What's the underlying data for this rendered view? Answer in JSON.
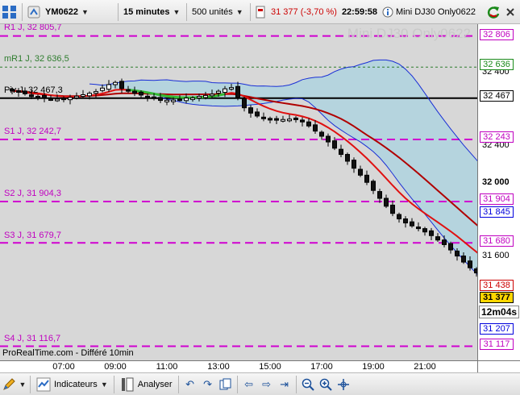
{
  "toolbar": {
    "instrument": "YM0622",
    "timeframe": "15 minutes",
    "units": "500 unités",
    "price_change": "31 377 (-3,70 %)",
    "time": "22:59:58",
    "name": "Mini DJ30 Only0622",
    "accent": "#cc0000"
  },
  "chart": {
    "watermark": "Mini DJ30 Only0622",
    "footer_note": "ProRealTime.com - Différé 10min",
    "levels": [
      {
        "key": "r1",
        "label": "R1 J, 32 805,7",
        "tag": "32 806"
      },
      {
        "key": "mr1",
        "label": "mR1 J, 32 636,5",
        "tag": "32 636"
      },
      {
        "key": "piv",
        "label": "Piv J, 32 467,3",
        "tag": "32 467"
      },
      {
        "key": "s1",
        "label": "S1 J, 32 242,7",
        "tag": "32 243"
      },
      {
        "key": "s2",
        "label": "S2 J, 31 904,3",
        "tag": "31 904"
      },
      {
        "key": "s3",
        "label": "S3 J, 31 679,7",
        "tag": "31 680"
      },
      {
        "key": "s4",
        "label": "S4 J, 31 116,7",
        "tag": "31 117"
      }
    ],
    "indicator_tags": {
      "upper_band": "31 845",
      "moving_average": "31 438",
      "last_price": "31 377",
      "lower_band": "31 207"
    },
    "countdown": "12m04s",
    "y_ticks": [
      "32 400",
      "32 000",
      "31 600"
    ],
    "x_ticks": [
      "07:00",
      "09:00",
      "11:00",
      "13:00",
      "15:00",
      "17:00",
      "19:00",
      "21:00"
    ]
  },
  "bottom": {
    "indicators_label": "Indicateurs",
    "analyser_label": "Analyser"
  },
  "chart_data": {
    "type": "candlestick",
    "x_start": "05:00",
    "interval_minutes": 15,
    "close": [
      32508,
      32500,
      32491,
      32477,
      32476,
      32470,
      32462,
      32462,
      32465,
      32471,
      32478,
      32486,
      32494,
      32503,
      32522,
      32541,
      32553,
      32520,
      32505,
      32494,
      32484,
      32474,
      32465,
      32455,
      32456,
      32457,
      32460,
      32468,
      32469,
      32477,
      32482,
      32489,
      32505,
      32518,
      32525,
      32471,
      32415,
      32386,
      32370,
      32357,
      32350,
      32351,
      32351,
      32353,
      32354,
      32338,
      32316,
      32288,
      32260,
      32229,
      32195,
      32161,
      32124,
      32086,
      32048,
      32009,
      31965,
      31922,
      31879,
      31840,
      31810,
      31788,
      31772,
      31757,
      31739,
      31719,
      31695,
      31670,
      31641,
      31608,
      31575,
      31544,
      31516,
      31491,
      31467,
      31443,
      31417,
      31395,
      31379,
      31367,
      31359,
      31367,
      31377
    ],
    "upper_band": [
      32545,
      32542,
      32538,
      32542,
      32549,
      32556,
      32560,
      32561,
      32566,
      32565,
      32564,
      32566,
      32567,
      32563,
      32560,
      32558,
      32560,
      32560,
      32559,
      32552,
      32550,
      32550,
      32549,
      32549,
      32543,
      32536,
      32533,
      32534,
      32532,
      32531,
      32533,
      32539,
      32552,
      32568,
      32576,
      32581,
      32582,
      32593,
      32612,
      32626,
      32635,
      32639,
      32651,
      32661,
      32673,
      32675,
      32675,
      32668,
      32653,
      32625,
      32589,
      32544,
      32494,
      32443,
      32393,
      32346,
      32300,
      32256,
      32212,
      32172,
      32132,
      32092,
      32055,
      32017,
      31985,
      31954,
      31930,
      31908,
      31888,
      31871,
      31845
    ],
    "lower_band": [
      32473,
      32462,
      32455,
      32447,
      32439,
      32434,
      32430,
      32428,
      32425,
      32424,
      32423,
      32424,
      32425,
      32427,
      32431,
      32434,
      32438,
      32444,
      32449,
      32457,
      32462,
      32466,
      32464,
      32446,
      32416,
      32381,
      32347,
      32318,
      32294,
      32271,
      32250,
      32229,
      32204,
      32176,
      32143,
      32102,
      32056,
      32008,
      31963,
      31919,
      31878,
      31836,
      31793,
      31749,
      31706,
      31666,
      31626,
      31588,
      31549,
      31513,
      31478,
      31446,
      31412,
      31375,
      31342,
      31311,
      31276,
      31242,
      31212,
      31207
    ],
    "ylim": [
      31040,
      32870
    ]
  }
}
